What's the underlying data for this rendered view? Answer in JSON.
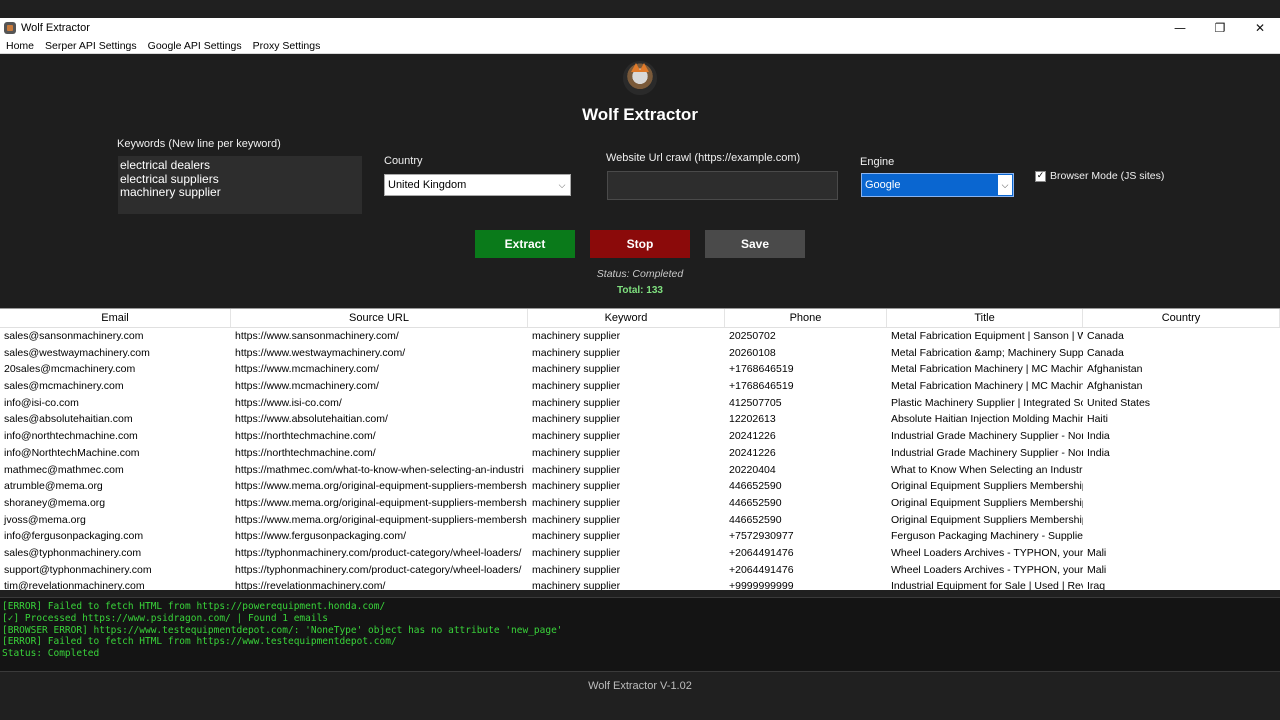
{
  "window": {
    "title": "Wolf Extractor",
    "controls": [
      "—",
      "❐",
      "✕"
    ]
  },
  "menu": {
    "items": [
      "Home",
      "Serper API Settings",
      "Google API Settings",
      "Proxy Settings"
    ]
  },
  "header": {
    "title": "Wolf Extractor"
  },
  "form": {
    "keywords_label": "Keywords (New line per keyword)",
    "keywords_lines": [
      "electrical dealers",
      "electrical suppliers",
      "machinery supplier"
    ],
    "country_label": "Country",
    "country_value": "United Kingdom",
    "url_label": "Website Url crawl (https://example.com)",
    "url_value": "",
    "engine_label": "Engine",
    "engine_value": "Google",
    "browser_mode_label": "Browser Mode (JS sites)",
    "browser_mode_checked": true
  },
  "buttons": {
    "extract": "Extract",
    "stop": "Stop",
    "save": "Save"
  },
  "status": {
    "text": "Status: Completed",
    "total": "Total: 133"
  },
  "table": {
    "columns": [
      "Email",
      "Source URL",
      "Keyword",
      "Phone",
      "Title",
      "Country"
    ],
    "rows": [
      [
        "sales@sansonmachinery.com",
        "https://www.sansonmachinery.com/",
        "machinery supplier",
        "20250702",
        "Metal Fabrication Equipment | Sanson | WA",
        "Canada"
      ],
      [
        "sales@westwaymachinery.com",
        "https://www.westwaymachinery.com/",
        "machinery supplier",
        "20260108",
        "Metal Fabrication &amp; Machinery Suppli",
        "Canada"
      ],
      [
        "20sales@mcmachinery.com",
        "https://www.mcmachinery.com/",
        "machinery supplier",
        "+1768646519",
        "Metal Fabrication Machinery | MC Machine",
        "Afghanistan"
      ],
      [
        "sales@mcmachinery.com",
        "https://www.mcmachinery.com/",
        "machinery supplier",
        "+1768646519",
        "Metal Fabrication Machinery | MC Machine",
        "Afghanistan"
      ],
      [
        "info@isi-co.com",
        "https://www.isi-co.com/",
        "machinery supplier",
        "412507705",
        "Plastic Machinery Supplier | Integrated Solu",
        "United States"
      ],
      [
        "sales@absolutehaitian.com",
        "https://www.absolutehaitian.com/",
        "machinery supplier",
        "12202613",
        "Absolute Haitian Injection Molding Machin",
        "Haiti"
      ],
      [
        "info@northtechmachine.com",
        "https://northtechmachine.com/",
        "machinery supplier",
        "20241226",
        "Industrial Grade Machinery Supplier - North",
        "India"
      ],
      [
        "info@NorthtechMachine.com",
        "https://northtechmachine.com/",
        "machinery supplier",
        "20241226",
        "Industrial Grade Machinery Supplier - North",
        "India"
      ],
      [
        "mathmec@mathmec.com",
        "https://mathmec.com/what-to-know-when-selecting-an-industri",
        "machinery supplier",
        "20220404",
        "What to Know When Selecting an Industrial",
        ""
      ],
      [
        "atrumble@mema.org",
        "https://www.mema.org/original-equipment-suppliers-membersh",
        "machinery supplier",
        "446652590",
        "Original Equipment Suppliers Membership",
        ""
      ],
      [
        "shoraney@mema.org",
        "https://www.mema.org/original-equipment-suppliers-membersh",
        "machinery supplier",
        "446652590",
        "Original Equipment Suppliers Membership",
        ""
      ],
      [
        "jvoss@mema.org",
        "https://www.mema.org/original-equipment-suppliers-membersh",
        "machinery supplier",
        "446652590",
        "Original Equipment Suppliers Membership",
        ""
      ],
      [
        "info@fergusonpackaging.com",
        "https://www.fergusonpackaging.com/",
        "machinery supplier",
        "+7572930977",
        "Ferguson Packaging Machinery - Supplier C",
        ""
      ],
      [
        "sales@typhonmachinery.com",
        "https://typhonmachinery.com/product-category/wheel-loaders/",
        "machinery supplier",
        "+2064491476",
        "Wheel Loaders Archives - TYPHON, your m",
        "Mali"
      ],
      [
        "support@typhonmachinery.com",
        "https://typhonmachinery.com/product-category/wheel-loaders/",
        "machinery supplier",
        "+2064491476",
        "Wheel Loaders Archives - TYPHON, your m",
        "Mali"
      ],
      [
        "tim@revelationmachinery.com",
        "https://revelationmachinery.com/",
        "machinery supplier",
        "+9999999999",
        "Industrial Equipment for Sale | Used | Revela",
        "Iraq"
      ]
    ]
  },
  "log": {
    "lines": [
      "[ERROR] Failed to fetch HTML from https://powerequipment.honda.com/",
      "[✓] Processed https://www.psidragon.com/ | Found 1 emails",
      "[BROWSER ERROR] https://www.testequipmentdepot.com/: 'NoneType' object has no attribute 'new_page'",
      "[ERROR] Failed to fetch HTML from https://www.testequipmentdepot.com/",
      "Status: Completed"
    ]
  },
  "footer": {
    "version": "Wolf Extractor V-1.02"
  },
  "colors": {
    "background": "#1e1e1e",
    "extract": "#0a7a1a",
    "stop": "#8b0a0a",
    "save": "#4a4a4a",
    "engine_select": "#0a66d0",
    "log_text": "#39d43a",
    "total_text": "#7fe07f"
  },
  "icons": {
    "app": "wolf-icon",
    "logo": "wolf-logo"
  }
}
